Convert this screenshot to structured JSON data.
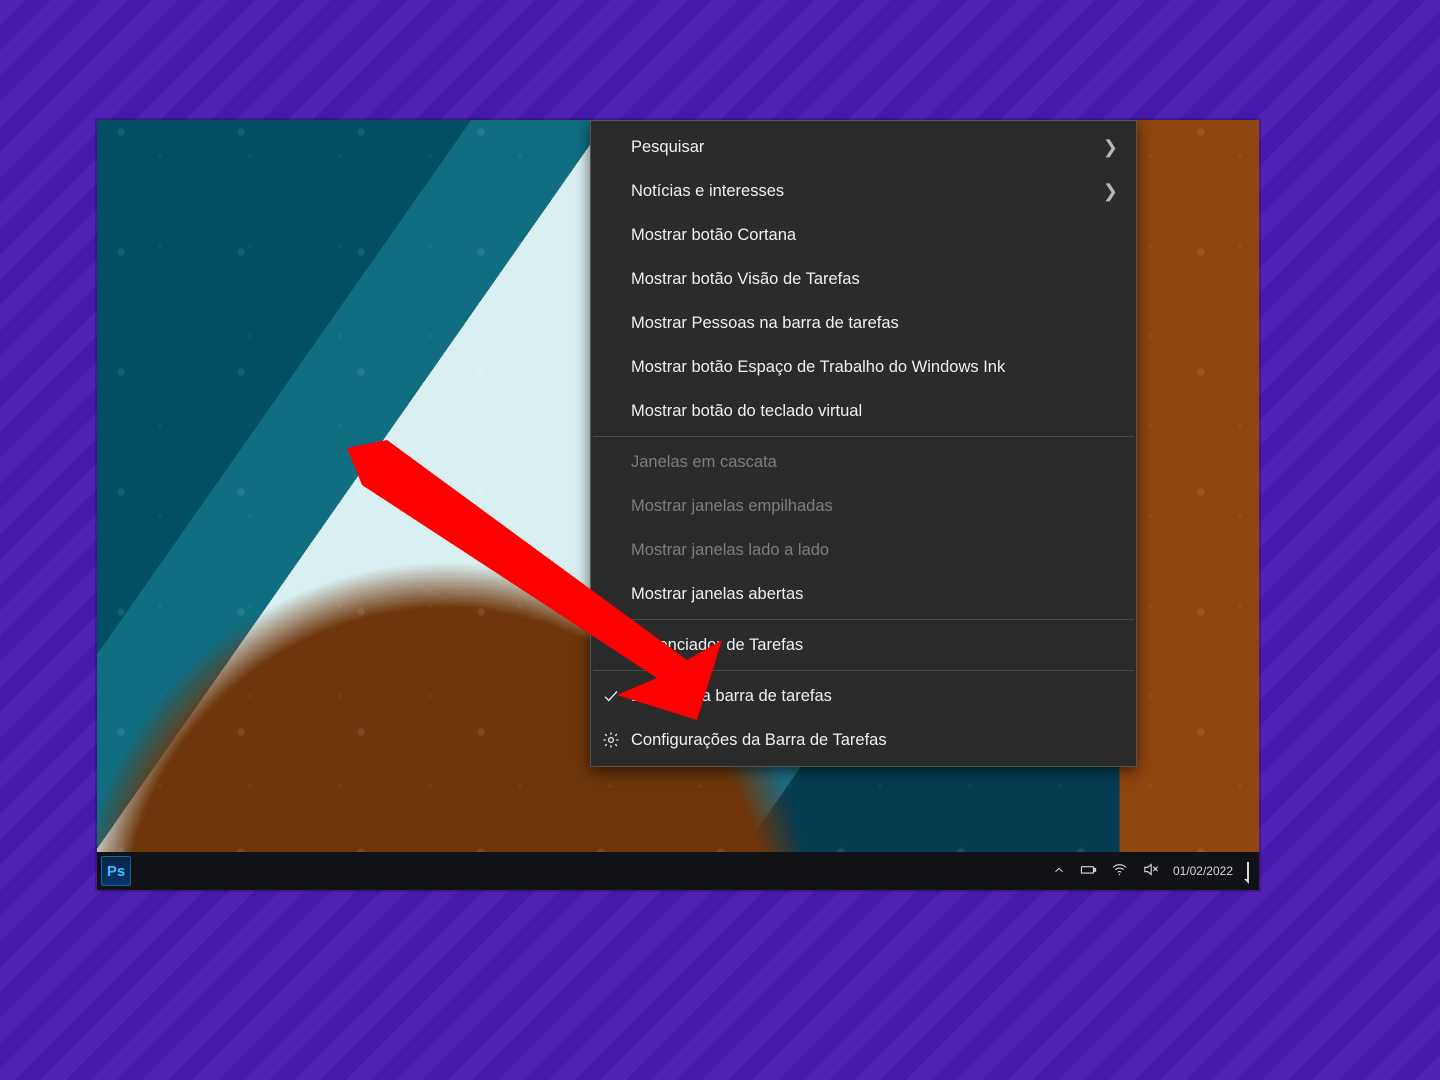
{
  "colors": {
    "backdrop": "#4b1db3",
    "menu_bg": "#2b2b2b",
    "menu_text": "#f0f0f0",
    "menu_disabled": "#7d7d7d",
    "arrow": "#ff0000"
  },
  "taskbar": {
    "app_badge": "Ps",
    "date": "01/02/2022"
  },
  "tray_icons": [
    "tray-chevron-up-icon",
    "battery-icon",
    "wifi-icon",
    "volume-muted-icon"
  ],
  "context_menu": {
    "groups": [
      [
        {
          "id": "search",
          "label": "Pesquisar",
          "submenu": true,
          "disabled": false,
          "icon": null
        },
        {
          "id": "news",
          "label": "Notícias e interesses",
          "submenu": true,
          "disabled": false,
          "icon": null
        },
        {
          "id": "cortana",
          "label": "Mostrar botão Cortana",
          "submenu": false,
          "disabled": false,
          "icon": null
        },
        {
          "id": "taskview",
          "label": "Mostrar botão Visão de Tarefas",
          "submenu": false,
          "disabled": false,
          "icon": null
        },
        {
          "id": "people",
          "label": "Mostrar Pessoas na barra de tarefas",
          "submenu": false,
          "disabled": false,
          "icon": null
        },
        {
          "id": "ink",
          "label": "Mostrar botão Espaço de Trabalho do Windows Ink",
          "submenu": false,
          "disabled": false,
          "icon": null
        },
        {
          "id": "touchkb",
          "label": "Mostrar botão do teclado virtual",
          "submenu": false,
          "disabled": false,
          "icon": null
        }
      ],
      [
        {
          "id": "cascade",
          "label": "Janelas em cascata",
          "submenu": false,
          "disabled": true,
          "icon": null
        },
        {
          "id": "stacked",
          "label": "Mostrar janelas empilhadas",
          "submenu": false,
          "disabled": true,
          "icon": null
        },
        {
          "id": "sidebyside",
          "label": "Mostrar janelas lado a lado",
          "submenu": false,
          "disabled": true,
          "icon": null
        },
        {
          "id": "openwins",
          "label": "Mostrar janelas abertas",
          "submenu": false,
          "disabled": false,
          "icon": null
        }
      ],
      [
        {
          "id": "taskmgr",
          "label": "Gerenciador de Tarefas",
          "submenu": false,
          "disabled": false,
          "icon": null
        }
      ],
      [
        {
          "id": "lockbar",
          "label": "Bloquear a barra de tarefas",
          "submenu": false,
          "disabled": false,
          "icon": "check-icon"
        },
        {
          "id": "barsettings",
          "label": "Configurações da Barra de Tarefas",
          "submenu": false,
          "disabled": false,
          "icon": "gear-icon"
        }
      ]
    ]
  },
  "annotation": {
    "points_to": "taskmgr"
  }
}
